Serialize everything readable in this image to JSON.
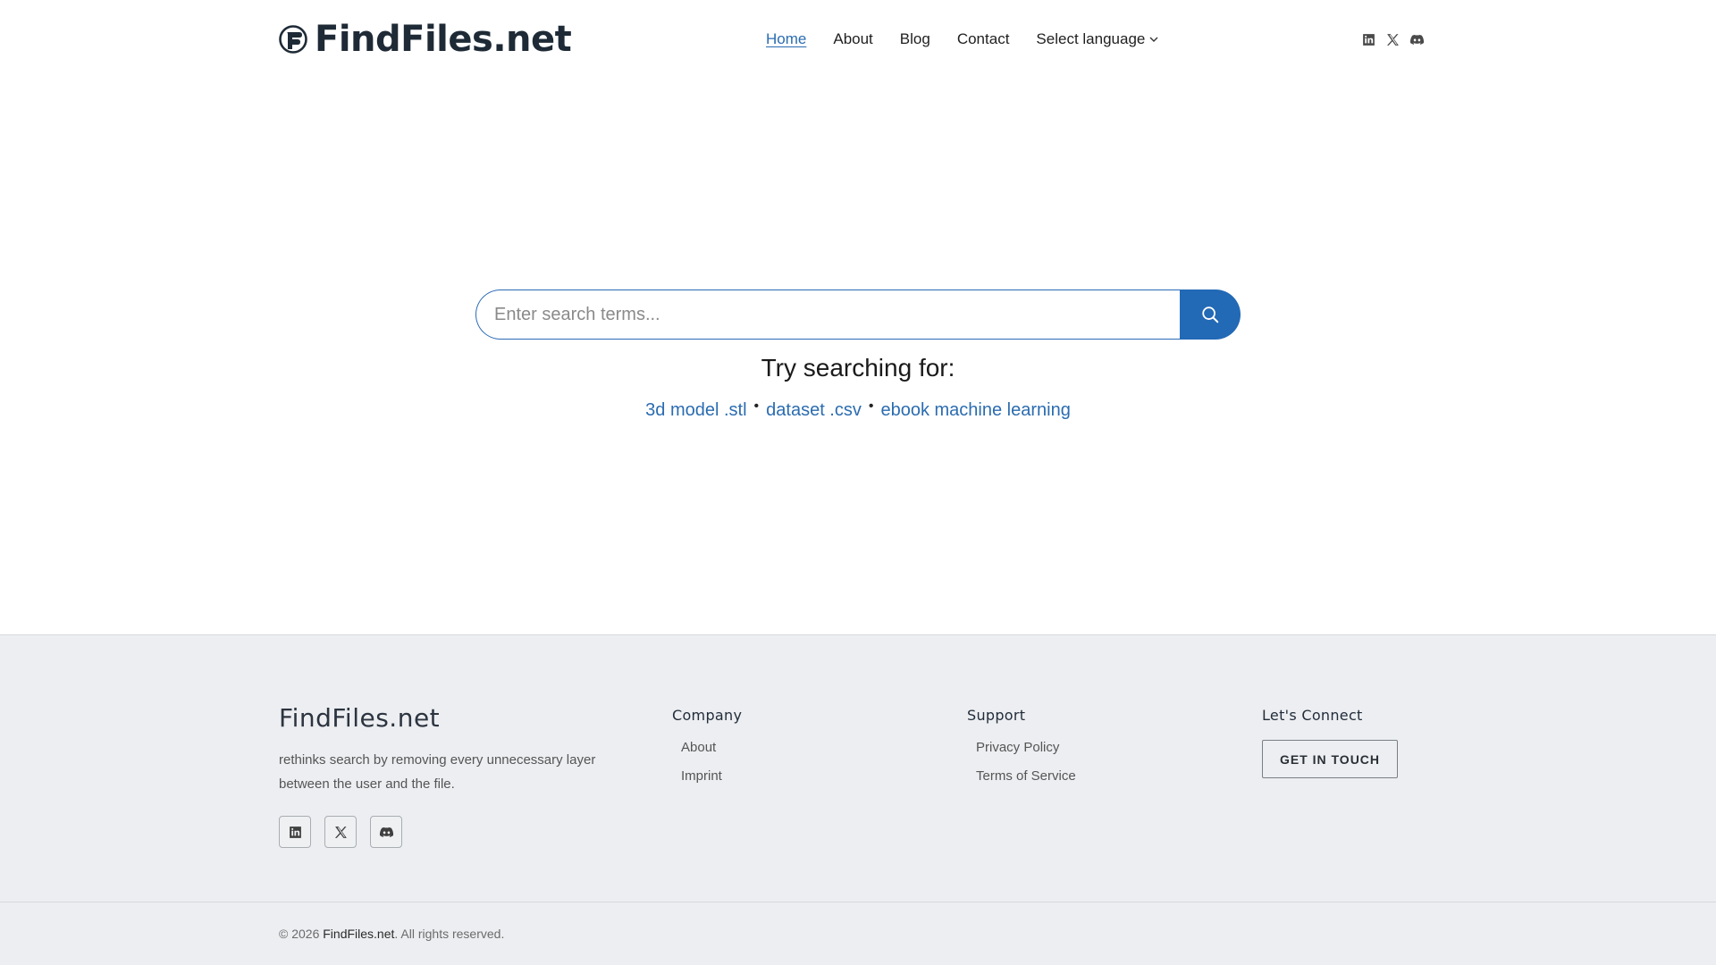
{
  "header": {
    "logo_text": "FindFiles.net",
    "nav": {
      "home": "Home",
      "about": "About",
      "blog": "Blog",
      "contact": "Contact",
      "language": "Select language"
    },
    "social_icons": [
      "linkedin-icon",
      "x-icon",
      "discord-icon"
    ]
  },
  "search": {
    "placeholder": "Enter search terms...",
    "value": "",
    "button_icon": "search-icon",
    "try_title": "Try searching for:",
    "suggestions": [
      "3d model .stl",
      "dataset .csv",
      "ebook machine learning"
    ],
    "separator": "•"
  },
  "footer": {
    "brand": "FindFiles.net",
    "description": "rethinks search by removing every unnecessary layer between the user and the file.",
    "company": {
      "title": "Company",
      "links": [
        "About",
        "Imprint"
      ]
    },
    "support": {
      "title": "Support",
      "links": [
        "Privacy Policy",
        "Terms of Service"
      ]
    },
    "connect": {
      "title": "Let's Connect",
      "button": "GET IN TOUCH"
    },
    "copyright_prefix": "© 2026",
    "copyright_brand": "FindFiles.net",
    "copyright_suffix": ". All rights reserved."
  },
  "colors": {
    "accent": "#2269b6",
    "link": "#2b6cb0",
    "footer_bg": "#eceef1",
    "logo_dark": "#1e2a36"
  }
}
